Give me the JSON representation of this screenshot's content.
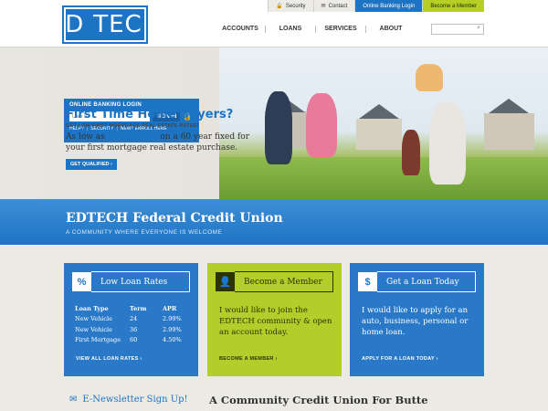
{
  "logo": {
    "left": "ED",
    "right": "TECH"
  },
  "utility": {
    "security": "Security",
    "contact": "Contact",
    "online_banking": "Online Banking Login",
    "member": "Become a Member"
  },
  "nav": {
    "items": [
      "ACCOUNTS",
      "LOANS",
      "SERVICES",
      "ABOUT"
    ]
  },
  "login": {
    "title": "ONLINE BANKING LOGIN",
    "placeholder": "User ID",
    "button": "SIGN IN",
    "help": "HELP?",
    "security": "SECURITY",
    "enroll": "NEW? ENROLL HERE"
  },
  "promo": {
    "title": "First Time Home Buyers?",
    "subtitle": "GET LOW FIRST MORTGAGE REAL ESTATE RATES!",
    "body_prefix": "As low as ",
    "apr": "4.50% APR",
    "body_suffix": " on a 60 year fixed for your first mortgage real estate purchase.",
    "cta": "GET QUALIFIED"
  },
  "band": {
    "title": "EDTECH Federal Credit Union",
    "tagline": "A COMMUNITY WHERE EVERYONE IS WELCOME"
  },
  "cards": {
    "rates": {
      "icon": "%",
      "title": "Low Loan Rates",
      "headers": [
        "Loan Type",
        "Term",
        "APR"
      ],
      "rows": [
        [
          "New Vehicle",
          "24",
          "2.99%"
        ],
        [
          "New Vehicle",
          "36",
          "2.99%"
        ],
        [
          "First Mortgage",
          "60",
          "4.50%"
        ]
      ],
      "link": "VIEW ALL LOAN RATES"
    },
    "member": {
      "title": "Become a Member",
      "text": "I would like to join the EDTECH community & open an account today.",
      "link": "BECOME A MEMBER"
    },
    "loan": {
      "title": "Get a Loan Today",
      "text": "I would like to apply for an auto, business, personal or home loan.",
      "link": "APPLY FOR A LOAN TODAY"
    }
  },
  "newsletter": "E-Newsletter Sign Up!",
  "community_heading": "A Community Credit Union For Butte",
  "colors": {
    "brand_blue": "#1e74c4",
    "brand_green": "#b3cd2a"
  }
}
